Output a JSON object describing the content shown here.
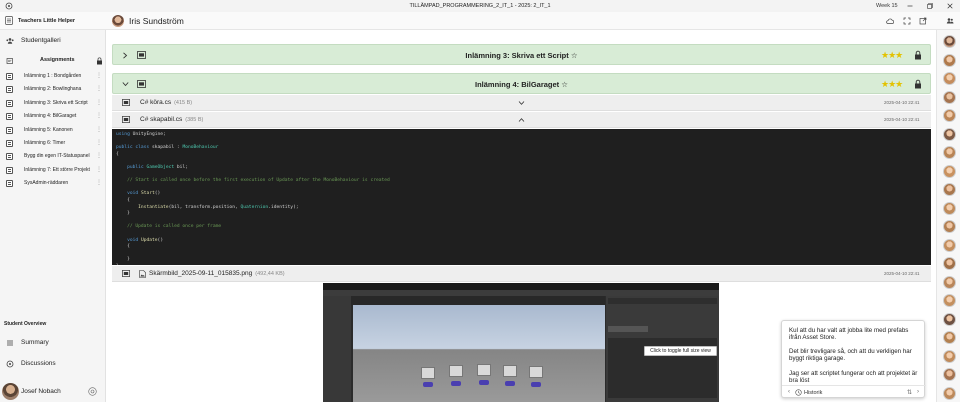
{
  "window": {
    "title": "TILLÄMPAD_PROGRAMMERING_2_IT_1 - 2025: 2_IT_1",
    "week": "Week 15"
  },
  "header": {
    "app_name": "Teachers Little Helper",
    "user_name": "Iris Sundström"
  },
  "sidebar": {
    "gallery_label": "Studentgalleri",
    "assignments_label": "Assignments",
    "items": [
      {
        "label": "Inlämning 1 : Bondgården"
      },
      {
        "label": "Inlämning 2: Bowlinghana"
      },
      {
        "label": "Inlämning 3: Skriva ett Script"
      },
      {
        "label": "Inlämning 4: BilGaraget"
      },
      {
        "label": "Inlämning 5: Kanonen"
      },
      {
        "label": "Inlämning 6: Timer"
      },
      {
        "label": "Bygg din egen IT-Statuspanel"
      },
      {
        "label": "Inlämning 7: Ett större Projekt"
      },
      {
        "label": "SysAdmin-räddaren"
      }
    ],
    "student_overview": "Student Overview",
    "summary_label": "Summary",
    "discussions_label": "Discussions",
    "teacher_name": "Josef Nobach"
  },
  "main": {
    "band1_title": "Inlämning 3: Skriva ett Script",
    "band2_title": "Inlämning 4: BilGaraget",
    "files": [
      {
        "name": "C# köra.cs",
        "size": "(415 B)",
        "date": "2025-04-10 22:41"
      },
      {
        "name": "C# skapabil.cs",
        "size": "(385 B)",
        "date": "2025-04-10 22:41"
      },
      {
        "name": "Skärmbild_2025-09-11_015835.png",
        "size": "(492,44 KB)",
        "date": "2025-04-10 22:41"
      }
    ],
    "code_lines": [
      "using UnityEngine;",
      "",
      "public class skapabil : MonoBehaviour",
      "{",
      "",
      "    public GameObject bil;",
      "",
      "    // Start is called once before the first execution of Update after the MonoBehaviour is created",
      "",
      "    void Start()",
      "    {",
      "        Instantiate(bil, transform.position, Quaternion.identity);",
      "    }",
      "",
      "    // Update is called once per frame",
      "",
      "    void Update()",
      "    {",
      "",
      "    }",
      "}"
    ],
    "tooltip": "Click to toggle full size view"
  },
  "chat": {
    "msg1": "Kul att du har valt att jobba lite med prefabs ifrån Asset Store.",
    "msg2": "Det blir trevligare så, och att du verkligen har byggt riktiga garage.",
    "msg3": "Jag ser att scriptet fungerar och att projektet är bra löst",
    "history_label": "Historik"
  },
  "colors": {
    "band_bg": "#d8ecd6",
    "star_yellow": "#e3c200",
    "code_bg": "#1f1f1f"
  }
}
